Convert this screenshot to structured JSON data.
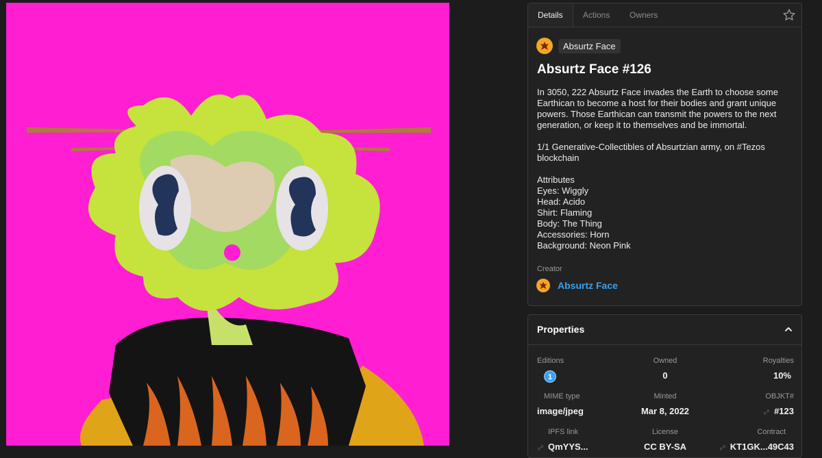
{
  "tabs": [
    {
      "label": "Details",
      "active": true
    },
    {
      "label": "Actions",
      "active": false
    },
    {
      "label": "Owners",
      "active": false
    }
  ],
  "collection": {
    "name": "Absurtz Face"
  },
  "token": {
    "title": "Absurtz Face #126",
    "description": "In 3050, 222 Absurtz Face invades the Earth to choose some Earthican to become a host for their bodies and grant unique powers. Those Earthican can transmit the powers to the next generation, or keep it to themselves and be immortal.\n\n1/1 Generative-Collectibles of Absurtzian army, on #Tezos blockchain\n\nAttributes\nEyes: Wiggly\nHead: Acido\nShirt: Flaming\nBody: The Thing\nAccessories: Horn\nBackground: Neon Pink"
  },
  "creator": {
    "label": "Creator",
    "name": "Absurtz Face"
  },
  "properties": {
    "title": "Properties",
    "editions": {
      "label": "Editions",
      "value": "1"
    },
    "owned": {
      "label": "Owned",
      "value": "0"
    },
    "royalties": {
      "label": "Royalties",
      "value": "10%"
    },
    "mime": {
      "label": "MIME type",
      "value": "image/jpeg"
    },
    "minted": {
      "label": "Minted",
      "value": "Mar 8, 2022"
    },
    "objkt": {
      "label": "OBJKT#",
      "value": "#123"
    },
    "ipfs": {
      "label": "IPFS link",
      "value": "QmYYS..."
    },
    "license": {
      "label": "License",
      "value": "CC BY-SA"
    },
    "contract": {
      "label": "Contract",
      "value": "KT1GK...49C43"
    }
  },
  "colors": {
    "background": "#ff1ed2",
    "accent": "#3aa0f0",
    "logo": "#f5a623"
  },
  "icons": [
    "star-icon",
    "chevron-up-icon",
    "link-icon",
    "collection-logo-icon"
  ]
}
